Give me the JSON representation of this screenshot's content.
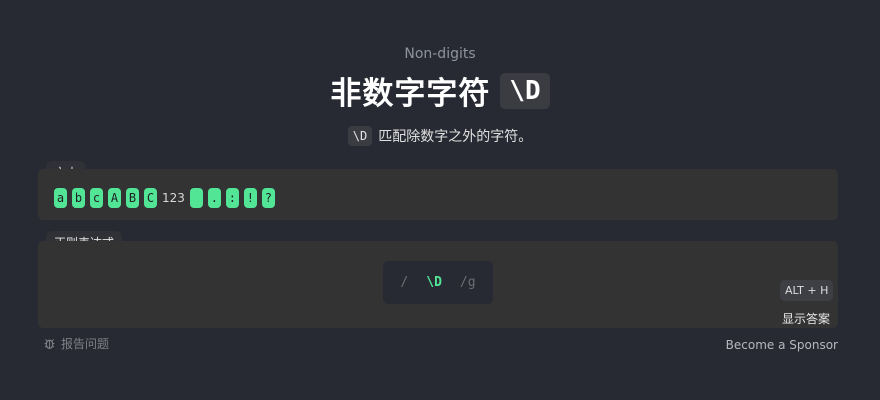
{
  "header": {
    "subtitle": "Non-digits",
    "title": "非数字字符",
    "title_code": "\\D",
    "desc_code": "\\D",
    "desc_text": "匹配除数字之外的字符。"
  },
  "text_panel": {
    "label": "文本",
    "tokens": [
      {
        "text": "a",
        "highlight": true
      },
      {
        "text": "b",
        "highlight": true
      },
      {
        "text": "c",
        "highlight": true
      },
      {
        "text": "A",
        "highlight": true
      },
      {
        "text": "B",
        "highlight": true
      },
      {
        "text": "C",
        "highlight": true
      },
      {
        "text": "123",
        "highlight": false
      },
      {
        "text": " ",
        "highlight": true
      },
      {
        "text": ".",
        "highlight": true
      },
      {
        "text": ":",
        "highlight": true
      },
      {
        "text": "!",
        "highlight": true
      },
      {
        "text": "?",
        "highlight": true
      }
    ]
  },
  "regex_panel": {
    "label": "正则表达式",
    "open_slash": "/",
    "value": "\\D",
    "flags": "/g"
  },
  "hint": {
    "shortcut": "ALT + H",
    "show_answer": "显示答案"
  },
  "footer": {
    "report_icon": "bug-icon",
    "report": "报告问题",
    "sponsor": "Become a Sponsor"
  },
  "colors": {
    "background": "#272a32",
    "panel": "#333333",
    "match": "#53e596"
  }
}
